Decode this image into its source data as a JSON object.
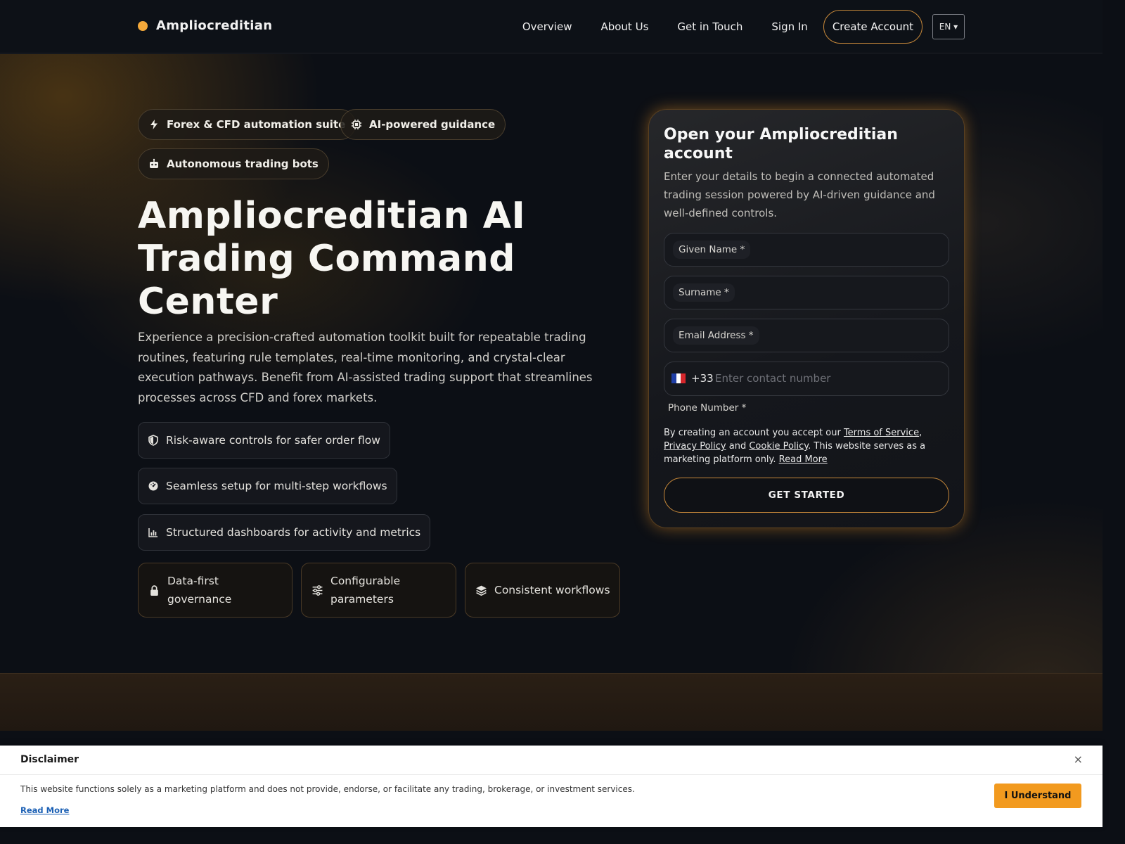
{
  "header": {
    "brand": "Ampliocreditian",
    "nav": [
      "Overview",
      "About Us",
      "Get in Touch",
      "Sign In"
    ],
    "create_account": "Create Account",
    "language": "EN ▾"
  },
  "hero": {
    "pills": [
      "Forex & CFD automation suite",
      "AI-powered guidance",
      "Autonomous trading bots"
    ],
    "title": "Ampliocreditian AI Trading Command Center",
    "description": "Experience a precision-crafted automation toolkit built for repeatable trading routines, featuring rule templates, real-time monitoring, and crystal-clear execution pathways. Benefit from AI-assisted trading support that streamlines processes across CFD and forex markets.",
    "features": [
      "Risk-aware controls for safer order flow",
      "Seamless setup for multi-step workflows",
      "Structured dashboards for activity and metrics"
    ],
    "stats": [
      "Data-first governance",
      "Configurable parameters",
      "Consistent workflows"
    ]
  },
  "form": {
    "title": "Open your Ampliocreditian account",
    "subtitle": "Enter your details to begin a connected automated trading session powered by AI-driven guidance and well-defined controls.",
    "given_name_label": "Given Name *",
    "surname_label": "Surname *",
    "email_label": "Email Address *",
    "phone_code": "+33",
    "phone_placeholder": "Enter contact number",
    "phone_label": "Phone Number *",
    "terms": {
      "prefix": "By creating an account you accept our ",
      "tos": "Terms of Service",
      "comma": ",",
      "privacy": "Privacy Policy",
      "and": " and ",
      "cookie": "Cookie Policy",
      "suffix": ". This website serves as a marketing platform only. ",
      "read_more": "Read More"
    },
    "submit": "GET STARTED"
  },
  "disclaimer": {
    "title": "Disclaimer",
    "close": "×",
    "text": "This website functions solely as a marketing platform and does not provide, endorse, or facilitate any trading, brokerage, or investment services.",
    "read_more": "Read More",
    "accept": "I Understand"
  },
  "colors": {
    "accent": "#f4a93a",
    "button_orange": "#f29a1f",
    "background": "#0c0f15"
  }
}
